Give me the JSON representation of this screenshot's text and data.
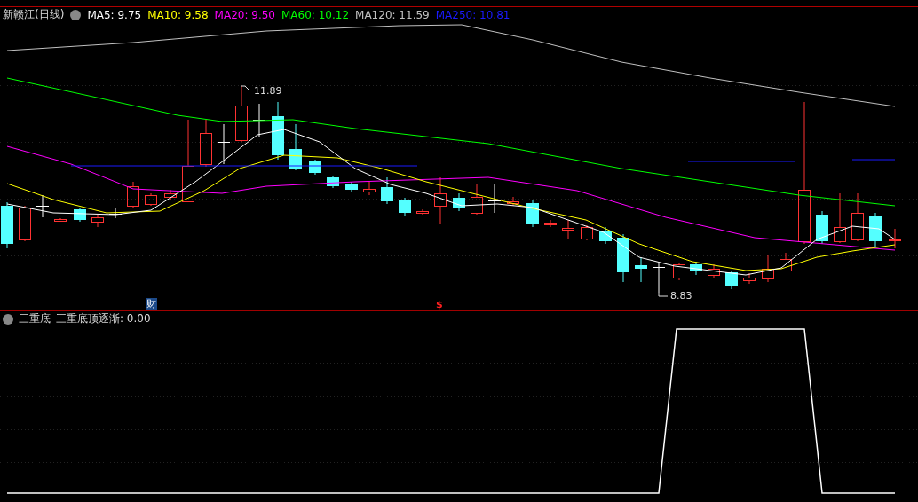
{
  "chart": {
    "title": "新赣江(日线)",
    "averages": [
      {
        "label": "MA5: 9.75",
        "color": "#ffffff"
      },
      {
        "label": "MA10: 9.58",
        "color": "#ffff00"
      },
      {
        "label": "MA20: 9.50",
        "color": "#ff00ff"
      },
      {
        "label": "MA60: 10.12",
        "color": "#00ff00"
      },
      {
        "label": "MA120: 11.59",
        "color": "#c0c0c0"
      },
      {
        "label": "MA250: 10.81",
        "color": "#1a1aff"
      }
    ],
    "high_label": "11.89",
    "low_label": "8.83",
    "markers": [
      {
        "kind": "finance",
        "text": "财"
      },
      {
        "kind": "dollar",
        "text": "$"
      }
    ]
  },
  "indicator_panel": {
    "title": "三重底",
    "reading": "三重底顶逐渐: 0.00"
  }
}
